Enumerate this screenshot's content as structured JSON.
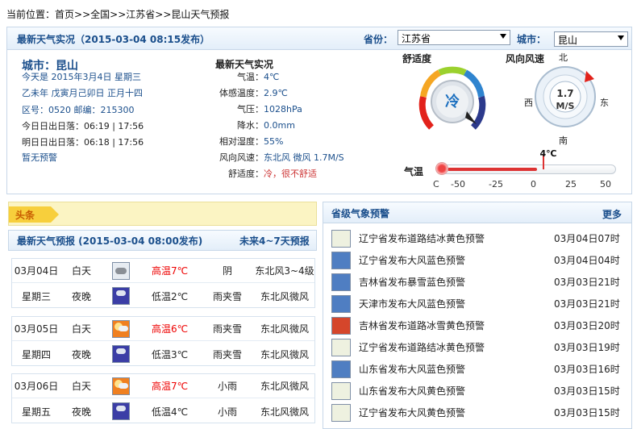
{
  "breadcrumb": {
    "prefix": "当前位置：",
    "home": "首页",
    "sep1": ">>",
    "country": "全国",
    "sep2": ">>",
    "province": "江苏省",
    "sep3": ">>",
    "page": "昆山天气预报"
  },
  "realtime": {
    "title": "最新天气实况（2015-03-04  08:15发布）",
    "province_label": "省份：",
    "province_value": "江苏省",
    "city_label": "城市：",
    "city_value": "昆山"
  },
  "info": {
    "city": "城市：昆山",
    "today": "今天是 2015年3月4日 星期三",
    "lunar": "乙未年 戊寅月己卯日 正月十四",
    "codes": "区号：0520  邮编：215300",
    "today_sun": "今日日出日落：06:19 | 17:56",
    "tomorrow_sun": "明日日出日落：06:18 | 17:56",
    "warning": "暂无预警"
  },
  "obs": {
    "title": "最新天气实况",
    "rows": [
      {
        "k": "气温：",
        "v": "4℃"
      },
      {
        "k": "体感温度：",
        "v": "2.9℃"
      },
      {
        "k": "气压：",
        "v": "1028hPa"
      },
      {
        "k": "降水：",
        "v": "0.0mm"
      },
      {
        "k": "相对湿度：",
        "v": "55%"
      },
      {
        "k": "风向风速：",
        "v": "东北风 微风 1.7M/S"
      },
      {
        "k": "舒适度：",
        "v": "冷，很不舒适"
      }
    ]
  },
  "comfort": {
    "title": "舒适度",
    "value": "冷"
  },
  "wind": {
    "title": "风向风速",
    "speed": "1.7",
    "unit": "M/S",
    "n": "北",
    "s": "南",
    "e": "东",
    "w": "西"
  },
  "temp": {
    "label": "气温",
    "value": "4℃",
    "ticks": [
      "C",
      "-50",
      "-25",
      "0",
      "25",
      "50"
    ],
    "current": 4
  },
  "news": {
    "tag": "头条"
  },
  "forecast": {
    "title": "最新天气预报 (2015-03-04  08:00发布)",
    "link": "未来4~7天预报",
    "days": [
      {
        "date": "03月04日",
        "weekday": "星期三",
        "day": {
          "period": "白天",
          "temp": "高温7℃",
          "weather": "阴",
          "wind": "东北风3~4级",
          "icon": "cloud"
        },
        "night": {
          "period": "夜晚",
          "temp": "低温2℃",
          "weather": "雨夹雪",
          "wind": "东北风微风",
          "icon": "snow"
        }
      },
      {
        "date": "03月05日",
        "weekday": "星期四",
        "day": {
          "period": "白天",
          "temp": "高温6℃",
          "weather": "雨夹雪",
          "wind": "东北风微风",
          "icon": "sun"
        },
        "night": {
          "period": "夜晚",
          "temp": "低温3℃",
          "weather": "雨夹雪",
          "wind": "东北风微风",
          "icon": "snow"
        }
      },
      {
        "date": "03月06日",
        "weekday": "星期五",
        "day": {
          "period": "白天",
          "temp": "高温7℃",
          "weather": "小雨",
          "wind": "东北风微风",
          "icon": "sun"
        },
        "night": {
          "period": "夜晚",
          "temp": "低温4℃",
          "weather": "小雨",
          "wind": "东北风微风",
          "icon": "snow"
        }
      }
    ]
  },
  "alerts": {
    "title": "省级气象预警",
    "more": "更多",
    "items": [
      {
        "text": "辽宁省发布道路结冰黄色预警",
        "time": "03月04日07时",
        "icon": "yellow"
      },
      {
        "text": "辽宁省发布大风蓝色预警",
        "time": "03月04日04时",
        "icon": "blue"
      },
      {
        "text": "吉林省发布暴雪蓝色预警",
        "time": "03月03日21时",
        "icon": "blue"
      },
      {
        "text": "天津市发布大风蓝色预警",
        "time": "03月03日21时",
        "icon": "blue"
      },
      {
        "text": "吉林省发布道路冰雪黄色预警",
        "time": "03月03日20时",
        "icon": "red"
      },
      {
        "text": "辽宁省发布道路结冰黄色预警",
        "time": "03月03日19时",
        "icon": "yellow"
      },
      {
        "text": "山东省发布大风蓝色预警",
        "time": "03月03日16时",
        "icon": "blue"
      },
      {
        "text": "山东省发布大风黄色预警",
        "time": "03月03日15时",
        "icon": "yellow"
      },
      {
        "text": "辽宁省发布大风黄色预警",
        "time": "03月03日15时",
        "icon": "yellow"
      }
    ]
  }
}
